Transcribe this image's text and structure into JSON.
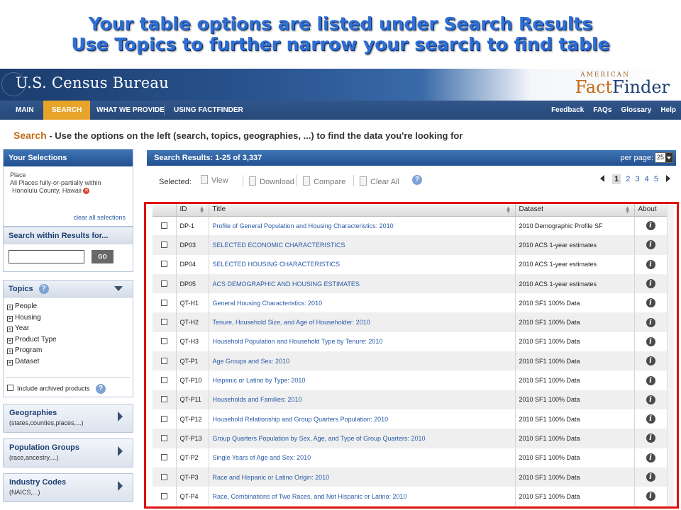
{
  "caption": {
    "line1": "Your table options are listed under Search Results",
    "line2": "Use Topics to further narrow your search to find table"
  },
  "banner": {
    "logo": "U.S. Census Bureau",
    "ff_top": "AMERICAN",
    "ff_fact": "Fact",
    "ff_finder": "Finder"
  },
  "nav": {
    "items": [
      "MAIN",
      "SEARCH",
      "WHAT WE PROVIDE",
      "USING FACTFINDER"
    ],
    "right": [
      "Feedback",
      "FAQs",
      "Glossary",
      "Help"
    ]
  },
  "page": {
    "section": "Search",
    "description": " - Use the options on the left (search, topics, geographies, ...) to find the data you're looking for"
  },
  "selections": {
    "title": "Your Selections",
    "label": "Place",
    "line1": "All Places fully-or-partially within",
    "line2": "Honolulu County, Hawaii",
    "remove_glyph": "✕",
    "clear": "clear all selections"
  },
  "search": {
    "title": "Search within Results for...",
    "value": "",
    "go": "GO"
  },
  "topics": {
    "title": "Topics",
    "help": "?",
    "items": [
      "People",
      "Housing",
      "Year",
      "Product Type",
      "Program",
      "Dataset"
    ],
    "archived": "Include archived products"
  },
  "accordions": [
    {
      "title": "Geographies",
      "sub": "(states,counties,places,...)"
    },
    {
      "title": "Population Groups",
      "sub": "(race,ancestry,...)"
    },
    {
      "title": "Industry Codes",
      "sub": "(NAICS,...)"
    }
  ],
  "results": {
    "title": "Search Results:",
    "range": "1-25",
    "of": "of",
    "total": "3,337",
    "per_page_label": "per page:",
    "per_page": "25",
    "selected_label": "Selected:",
    "tools": [
      "View",
      "Download",
      "Compare",
      "Clear All"
    ],
    "pages": [
      "1",
      "2",
      "3",
      "4",
      "5"
    ],
    "columns": [
      "ID",
      "Title",
      "Dataset",
      "About"
    ],
    "rows": [
      {
        "id": "DP-1",
        "title": "Profile of General Population and Housing Characteristics: 2010",
        "dataset": "2010 Demographic Profile SF"
      },
      {
        "id": "DP03",
        "title": "SELECTED ECONOMIC CHARACTERISTICS",
        "dataset": "2010 ACS 1-year estimates"
      },
      {
        "id": "DP04",
        "title": "SELECTED HOUSING CHARACTERISTICS",
        "dataset": "2010 ACS 1-year estimates"
      },
      {
        "id": "DP05",
        "title": "ACS DEMOGRAPHIC AND HOUSING ESTIMATES",
        "dataset": "2010 ACS 1-year estimates"
      },
      {
        "id": "QT-H1",
        "title": "General Housing Characteristics: 2010",
        "dataset": "2010 SF1 100% Data"
      },
      {
        "id": "QT-H2",
        "title": "Tenure, Household Size, and Age of Householder: 2010",
        "dataset": "2010 SF1 100% Data"
      },
      {
        "id": "QT-H3",
        "title": "Household Population and Household Type by Tenure: 2010",
        "dataset": "2010 SF1 100% Data"
      },
      {
        "id": "QT-P1",
        "title": "Age Groups and Sex: 2010",
        "dataset": "2010 SF1 100% Data"
      },
      {
        "id": "QT-P10",
        "title": "Hispanic or Latino by Type: 2010",
        "dataset": "2010 SF1 100% Data"
      },
      {
        "id": "QT-P11",
        "title": "Households and Families: 2010",
        "dataset": "2010 SF1 100% Data"
      },
      {
        "id": "QT-P12",
        "title": "Household Relationship and Group Quarters Population: 2010",
        "dataset": "2010 SF1 100% Data"
      },
      {
        "id": "QT-P13",
        "title": "Group Quarters Population by Sex, Age, and Type of Group Quarters: 2010",
        "dataset": "2010 SF1 100% Data"
      },
      {
        "id": "QT-P2",
        "title": "Single Years of Age and Sex: 2010",
        "dataset": "2010 SF1 100% Data"
      },
      {
        "id": "QT-P3",
        "title": "Race and Hispanic or Latino Origin: 2010",
        "dataset": "2010 SF1 100% Data"
      },
      {
        "id": "QT-P4",
        "title": "Race, Combinations of Two Races, and Not Hispanic or Latino: 2010",
        "dataset": "2010 SF1 100% Data"
      }
    ]
  },
  "icons": {
    "about": "info-icon",
    "help": "help-icon",
    "remove": "remove-icon"
  },
  "colors": {
    "nav_active": "#e8a42a",
    "highlight_box": "#e01010",
    "link": "#2a5ba8",
    "caption": "#2e6fd6"
  }
}
